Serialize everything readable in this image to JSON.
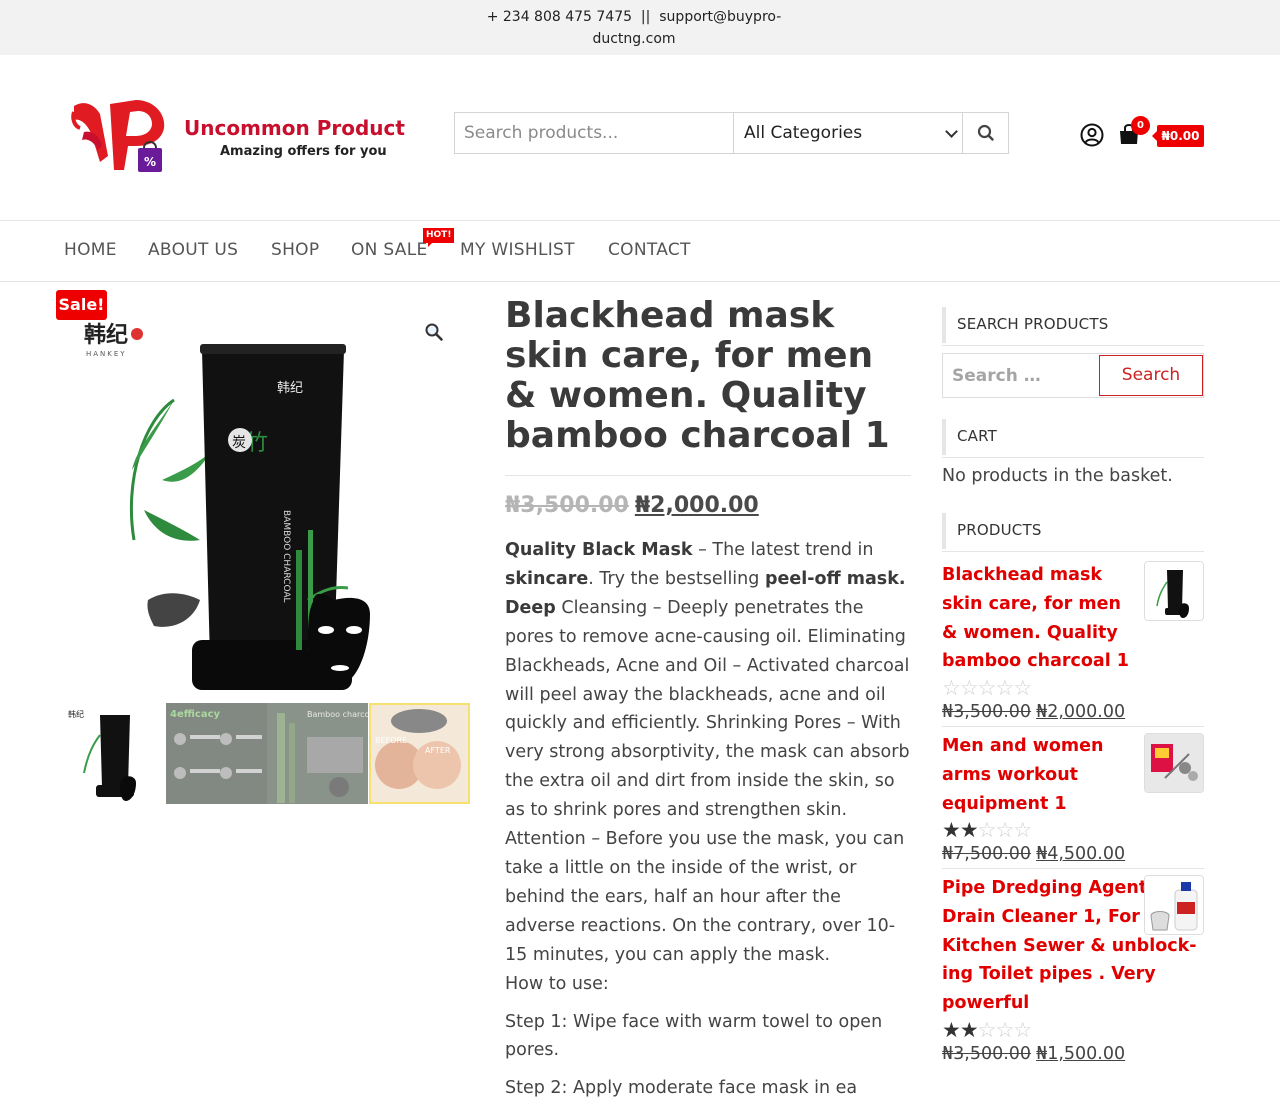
{
  "topbar": {
    "contact_line1": "+ 234 808 475 7475  ||  support@buypro-",
    "contact_line2": "ductng.com"
  },
  "header": {
    "logo_title": "Uncommon Product",
    "logo_tagline": "Amazing offers for you",
    "search_placeholder": "Search products...",
    "category_selected": "All Categories",
    "cart_count": "0",
    "cart_total": "₦0.00"
  },
  "nav": {
    "items": [
      "HOME",
      "ABOUT US",
      "SHOP",
      "ON SALE",
      "MY WISHLIST",
      "CONTACT"
    ],
    "hot_badge": "HOT!"
  },
  "gallery": {
    "sale_badge": "Sale!"
  },
  "product": {
    "title": "Blackhead mask skin care, for men & women. Quality bamboo charcoal 1",
    "old_price": "₦3,500.00",
    "new_price": "₦2,000.00",
    "desc_b1": "Quality Black Mask",
    "desc_t1": " – The latest trend in ",
    "desc_b2": "skincare",
    "desc_t2": ". Try the bestselling ",
    "desc_b3": "peel-off mask. Deep",
    "desc_t3": " Cleansing – Deeply penetrates the pores to remove acne-causing oil. Eliminating Blackheads, Acne and Oil – Activated charcoal will peel away the blackheads, acne and oil quickly and efficiently. Shrinking Pores – With very strong absorptivity, the mask can absorb the extra oil and dirt from inside the skin, so as to shrink pores and strengthen skin. Attention – Before you use the mask, you can take a little on the inside of the wrist, or behind the ears, half an hour after the adverse reactions. On the contrary, over 10-15 minutes, you can apply the mask.",
    "how_to_use": "How to use:",
    "step1": "Step 1: Wipe face with warm towel to open pores.",
    "step2": "Step 2: Apply moderate face mask in ea"
  },
  "sidebar": {
    "search_title": "SEARCH PRODUCTS",
    "search_placeholder": "Search …",
    "search_button": "Search",
    "cart_title": "CART",
    "cart_empty": "No products in the basket.",
    "products_title": "PRODUCTS",
    "products": [
      {
        "name": "Blackhead mask skin care, for men & women. Quality bamboo charcoal 1",
        "rating": 0,
        "old_price": "₦3,500.00",
        "new_price": "₦2,000.00"
      },
      {
        "name": "Men and women arms workout equipment 1",
        "rating": 2,
        "old_price": "₦7,500.00",
        "new_price": "₦4,500.00"
      },
      {
        "name": "Pipe Dredging Agent, Sink Drain Cleaner 1, For Kitchen Sewer & unblock-ing Toilet pipes . Very powerful",
        "rating": 2,
        "old_price": "₦3,500.00",
        "new_price": "₦1,500.00"
      }
    ]
  },
  "colors": {
    "accent": "#e00000",
    "topbar_bg": "#f2f2f2",
    "text": "#333333"
  }
}
